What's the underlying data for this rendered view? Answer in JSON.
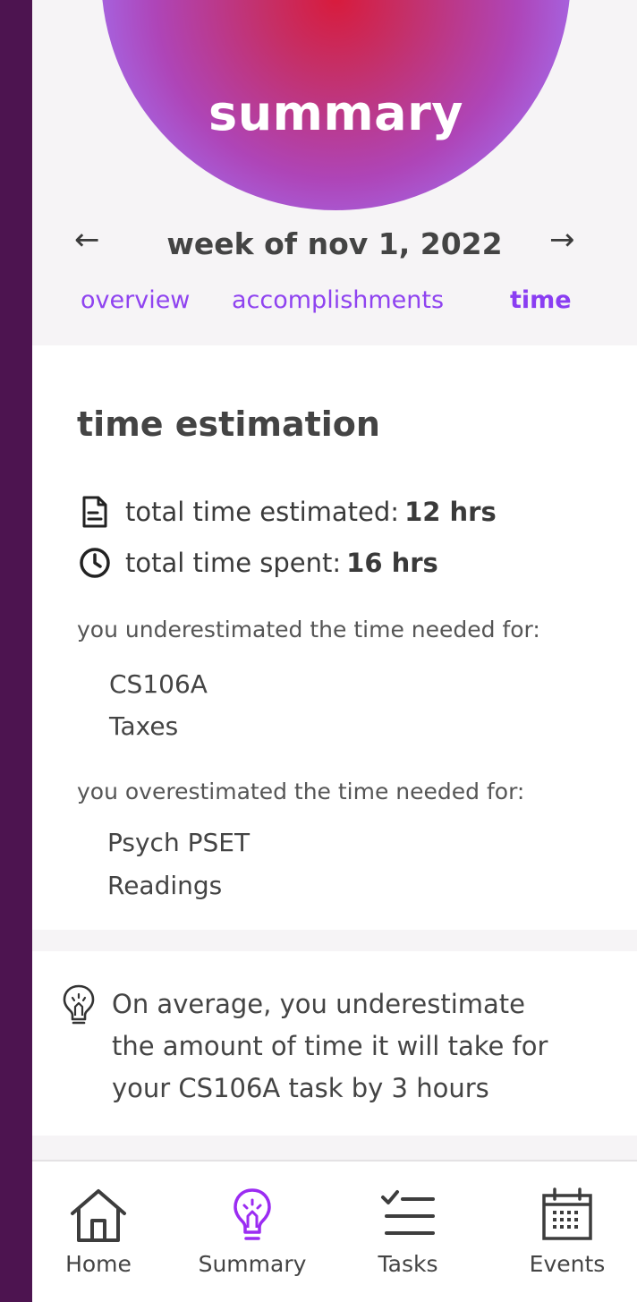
{
  "header": {
    "title": "summary"
  },
  "week_nav": {
    "title": "week of nov 1, 2022",
    "prev_arrow": "←",
    "next_arrow": "→"
  },
  "tabs": [
    {
      "label": "overview",
      "active": false
    },
    {
      "label": "accomplishments",
      "active": false
    },
    {
      "label": "time",
      "active": true
    }
  ],
  "time_estimation": {
    "title": "time estimation",
    "estimated_label": "total time estimated:",
    "estimated_value": "12 hrs",
    "spent_label": "total time spent:",
    "spent_value": "16 hrs",
    "underestimated_label": "you underestimated the time needed for:",
    "underestimated_items": [
      "CS106A",
      "Taxes"
    ],
    "overestimated_label": "you overestimated the time needed for:",
    "overestimated_items": [
      "Psych PSET",
      "Readings"
    ]
  },
  "tip": {
    "lines": [
      "On average, you underestimate",
      "the amount of time it will take for",
      "your CS106A task by 3 hours"
    ]
  },
  "bottom_nav": [
    {
      "label": "Home",
      "icon": "home-icon",
      "active": false
    },
    {
      "label": "Summary",
      "icon": "lightbulb-icon",
      "active": true
    },
    {
      "label": "Tasks",
      "icon": "checklist-icon",
      "active": false
    },
    {
      "label": "Events",
      "icon": "calendar-icon",
      "active": false
    }
  ],
  "colors": {
    "accent": "#8f43f0",
    "sidebar": "#4d1450",
    "text": "#444444"
  }
}
